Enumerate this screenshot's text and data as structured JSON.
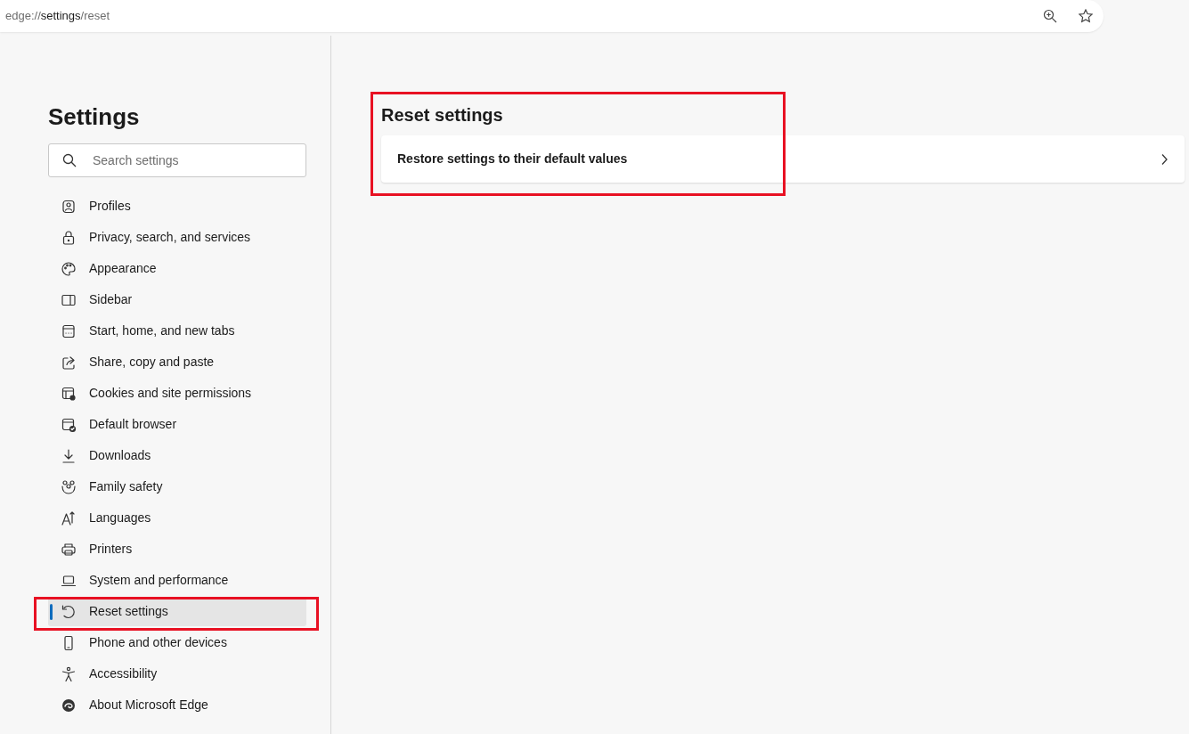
{
  "address_bar": {
    "scheme": "edge://",
    "host": "settings",
    "path": "/reset"
  },
  "sidebar": {
    "title": "Settings",
    "search": {
      "placeholder": "Search settings"
    },
    "items": [
      {
        "label": "Profiles",
        "selected": false,
        "highlighted": false
      },
      {
        "label": "Privacy, search, and services",
        "selected": false,
        "highlighted": false
      },
      {
        "label": "Appearance",
        "selected": false,
        "highlighted": false
      },
      {
        "label": "Sidebar",
        "selected": false,
        "highlighted": false
      },
      {
        "label": "Start, home, and new tabs",
        "selected": false,
        "highlighted": false
      },
      {
        "label": "Share, copy and paste",
        "selected": false,
        "highlighted": false
      },
      {
        "label": "Cookies and site permissions",
        "selected": false,
        "highlighted": false
      },
      {
        "label": "Default browser",
        "selected": false,
        "highlighted": false
      },
      {
        "label": "Downloads",
        "selected": false,
        "highlighted": false
      },
      {
        "label": "Family safety",
        "selected": false,
        "highlighted": false
      },
      {
        "label": "Languages",
        "selected": false,
        "highlighted": false
      },
      {
        "label": "Printers",
        "selected": false,
        "highlighted": false
      },
      {
        "label": "System and performance",
        "selected": false,
        "highlighted": false
      },
      {
        "label": "Reset settings",
        "selected": true,
        "highlighted": true
      },
      {
        "label": "Phone and other devices",
        "selected": false,
        "highlighted": false
      },
      {
        "label": "Accessibility",
        "selected": false,
        "highlighted": false
      },
      {
        "label": "About Microsoft Edge",
        "selected": false,
        "highlighted": false
      }
    ]
  },
  "main": {
    "title": "Reset settings",
    "highlighted": true,
    "rows": [
      {
        "label": "Restore settings to their default values"
      }
    ]
  }
}
